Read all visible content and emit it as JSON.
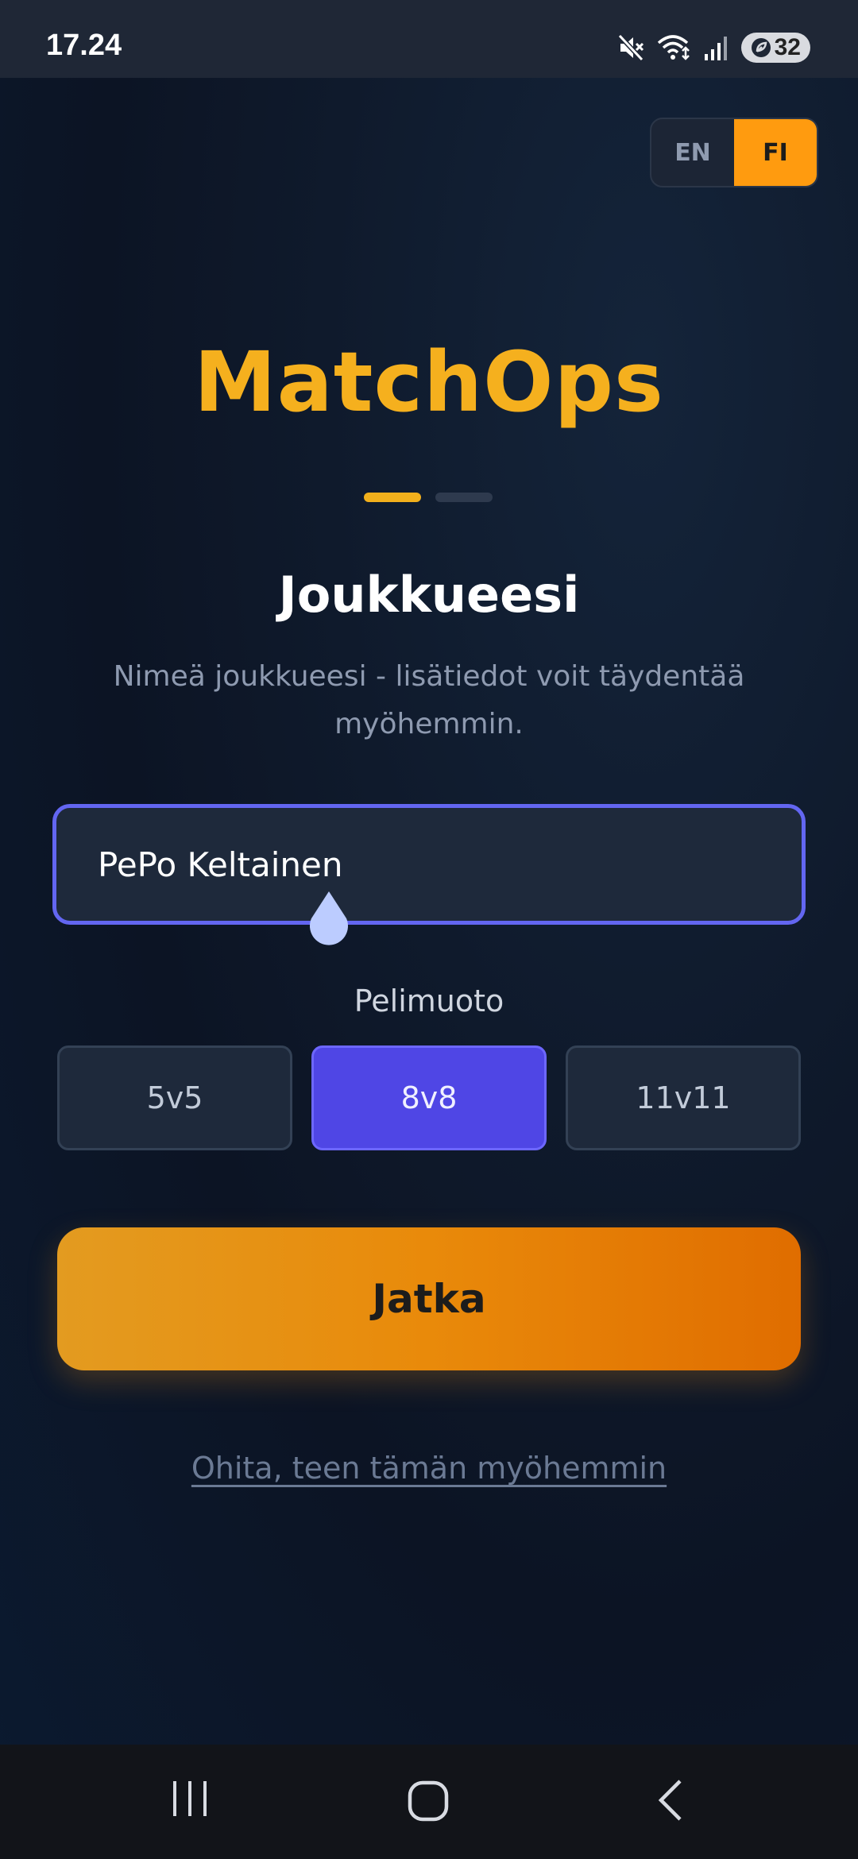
{
  "status_bar": {
    "time": "17.24",
    "battery": "32",
    "icons": [
      "mute-icon",
      "wifi-icon",
      "signal-icon",
      "battery-icon"
    ]
  },
  "language": {
    "options": [
      "EN",
      "FI"
    ],
    "selected": "FI"
  },
  "app": {
    "title": "MatchOps"
  },
  "steps": {
    "total": 2,
    "current": 1
  },
  "page": {
    "heading": "Joukkueesi",
    "subtext": "Nimeä joukkueesi - lisätiedot voit täydentää myöhemmin.",
    "team_name_value": "PePo Keltainen",
    "format_label": "Pelimuoto",
    "formats": [
      "5v5",
      "8v8",
      "11v11"
    ],
    "selected_format": "8v8",
    "continue_label": "Jatka",
    "skip_label": "Ohita, teen tämän myöhemmin"
  },
  "colors": {
    "accent": "#f5b01e",
    "primary": "#4f46e5",
    "button_orange": "#e98a0a",
    "lang_active": "#ff9b0f"
  },
  "nav_bar": {
    "icons": [
      "recent-apps-icon",
      "home-icon",
      "back-icon"
    ]
  }
}
